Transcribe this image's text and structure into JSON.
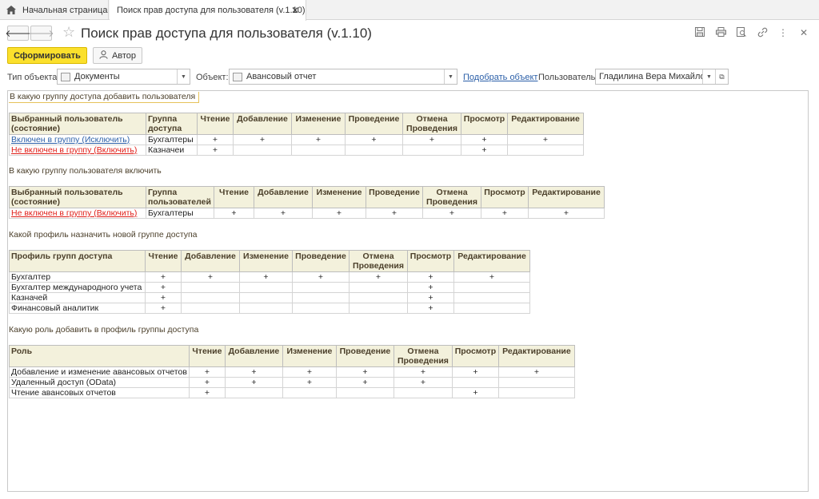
{
  "tabs": {
    "home": "Начальная страница",
    "active": "Поиск прав доступа для пользователя (v.1.10)"
  },
  "header": {
    "title": "Поиск прав доступа для пользователя (v.1.10)",
    "icons": [
      "save-icon",
      "print-icon",
      "preview-icon",
      "link-icon",
      "more-icon",
      "close-icon"
    ]
  },
  "commands": {
    "generate": "Сформировать",
    "author": "Автор"
  },
  "filters": {
    "object_type_label": "Тип объекта:",
    "object_type_value": "Документы",
    "object_label": "Объект:",
    "object_value": "Авансовый отчет",
    "pick_object": "Подобрать объект",
    "user_label": "Пользователь:",
    "user_value": "Гладилина Вера Михайлов"
  },
  "sections": [
    {
      "title": "В какую группу доступа добавить пользователя",
      "columns": [
        "Выбранный пользователь (состояние)",
        "Группа доступа",
        "Чтение",
        "Добавление",
        "Изменение",
        "Проведение",
        "Отмена Проведения",
        "Просмотр",
        "Редактирование"
      ],
      "rows": [
        [
          "Включен в группу (Исключить)",
          "Бухгалтеры",
          "+",
          "+",
          "+",
          "+",
          "+",
          "+",
          "+"
        ],
        [
          "Не включен в группу (Включить)",
          "Казначеи",
          "+",
          "",
          "",
          "",
          "",
          "+",
          ""
        ]
      ]
    },
    {
      "title": "В какую группу пользователя включить",
      "columns": [
        "Выбранный пользователь (состояние)",
        "Группа пользователей",
        "Чтение",
        "Добавление",
        "Изменение",
        "Проведение",
        "Отмена Проведения",
        "Просмотр",
        "Редактирование"
      ],
      "rows": [
        [
          "Не включен в группу (Включить)",
          "Бухгалтеры",
          "+",
          "+",
          "+",
          "+",
          "+",
          "+",
          "+"
        ]
      ]
    },
    {
      "title": "Какой профиль назначить новой группе доступа",
      "columns": [
        "Профиль групп доступа",
        "Чтение",
        "Добавление",
        "Изменение",
        "Проведение",
        "Отмена Проведения",
        "Просмотр",
        "Редактирование"
      ],
      "rows": [
        [
          "Бухгалтер",
          "+",
          "+",
          "+",
          "+",
          "+",
          "+",
          "+"
        ],
        [
          "Бухгалтер международного учета",
          "+",
          "",
          "",
          "",
          "",
          "+",
          ""
        ],
        [
          "Казначей",
          "+",
          "",
          "",
          "",
          "",
          "+",
          ""
        ],
        [
          "Финансовый аналитик",
          "+",
          "",
          "",
          "",
          "",
          "+",
          ""
        ]
      ]
    },
    {
      "title": "Какую роль добавить в профиль группы доступа",
      "columns": [
        "Роль",
        "Чтение",
        "Добавление",
        "Изменение",
        "Проведение",
        "Отмена Проведения",
        "Просмотр",
        "Редактирование"
      ],
      "rows": [
        [
          "Добавление и изменение авансовых отчетов",
          "+",
          "+",
          "+",
          "+",
          "+",
          "+",
          "+"
        ],
        [
          "Удаленный доступ (OData)",
          "+",
          "+",
          "+",
          "+",
          "+",
          "",
          ""
        ],
        [
          "Чтение авансовых отчетов",
          "+",
          "",
          "",
          "",
          "",
          "+",
          ""
        ]
      ]
    }
  ]
}
